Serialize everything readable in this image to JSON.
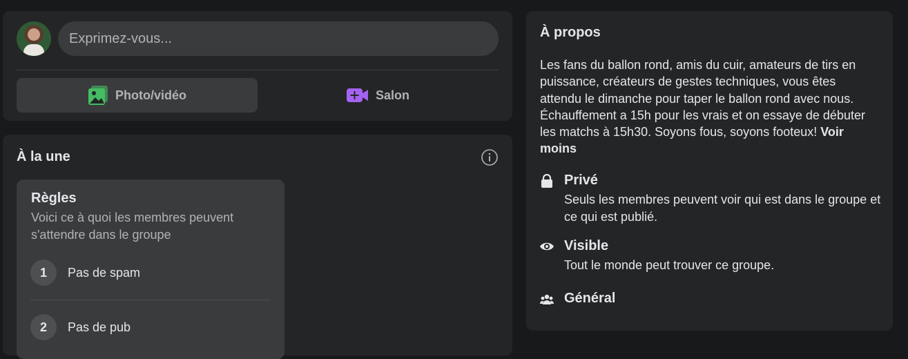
{
  "composer": {
    "placeholder": "Exprimez-vous...",
    "photo_label": "Photo/vidéo",
    "salon_label": "Salon",
    "photo_color": "#45bd62",
    "salon_color": "#a463f2"
  },
  "featured": {
    "title": "À la une",
    "rules": {
      "title": "Règles",
      "subtitle": "Voici ce à quoi les membres peuvent s'attendre dans le groupe",
      "items": [
        {
          "num": "1",
          "label": "Pas de spam"
        },
        {
          "num": "2",
          "label": "Pas de pub"
        }
      ]
    }
  },
  "about": {
    "title": "À propos",
    "description": "Les fans du ballon rond, amis du cuir, amateurs de tirs en puissance, créateurs de gestes techniques, vous êtes attendu le dimanche pour taper le ballon rond avec nous. Échauffement a 15h pour les vrais et on essaye de débuter les matchs à 15h30. Soyons fous, soyons footeux!",
    "see_less": "Voir moins",
    "items": [
      {
        "icon": "lock-icon",
        "title": "Privé",
        "description": "Seuls les membres peuvent voir qui est dans le groupe et ce qui est publié."
      },
      {
        "icon": "eye-icon",
        "title": "Visible",
        "description": "Tout le monde peut trouver ce groupe."
      },
      {
        "icon": "group-icon",
        "title": "Général",
        "description": ""
      }
    ]
  }
}
